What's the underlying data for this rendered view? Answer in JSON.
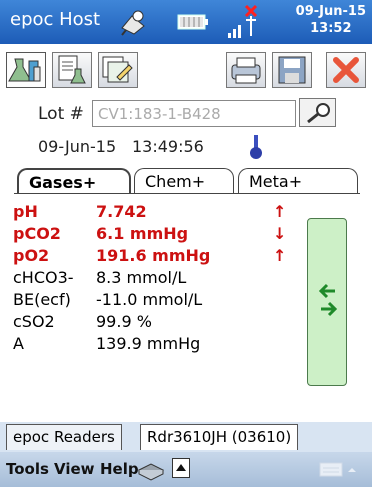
{
  "title_bar": {
    "app_title": "epoc Host",
    "date": "09-Jun-15",
    "time": "13:52",
    "icons": [
      "sync-icon",
      "battery-icon",
      "signal-icon"
    ]
  },
  "toolbar": {
    "buttons": [
      "test-results-icon",
      "document-icon",
      "edit-icon",
      "print-icon",
      "save-icon",
      "close-icon"
    ]
  },
  "lot": {
    "label": "Lot #",
    "value": "CV1:183-1-B428"
  },
  "test_info": {
    "date": "09-Jun-15",
    "time": "13:49:56"
  },
  "tabs": [
    {
      "label": "Gases+",
      "active": true
    },
    {
      "label": "Chem+",
      "active": false
    },
    {
      "label": "Meta+",
      "active": false
    }
  ],
  "results": [
    {
      "name": "pH",
      "value": "7.742",
      "flag": "↑",
      "abnormal": true
    },
    {
      "name": "pCO2",
      "value": "6.1  mmHg",
      "flag": "↓",
      "abnormal": true
    },
    {
      "name": "pO2",
      "value": "191.6  mmHg",
      "flag": "↑",
      "abnormal": true
    },
    {
      "name": "cHCO3-",
      "value": "8.3  mmol/L",
      "flag": "",
      "abnormal": false
    },
    {
      "name": "BE(ecf)",
      "value": "-11.0  mmol/L",
      "flag": "",
      "abnormal": false
    },
    {
      "name": "cSO2",
      "value": "99.9  %",
      "flag": "",
      "abnormal": false
    },
    {
      "name": "A",
      "value": "139.9  mmHg",
      "flag": "",
      "abnormal": false
    }
  ],
  "reader_tabs": [
    "epoc Readers",
    "Rdr3610JH (03610)"
  ],
  "menu": [
    "Tools",
    "View",
    "Help"
  ],
  "colors": {
    "abnormal": "#cc1111",
    "titlebar": "#2a6cc6",
    "side_button": "#cdf0c7"
  }
}
